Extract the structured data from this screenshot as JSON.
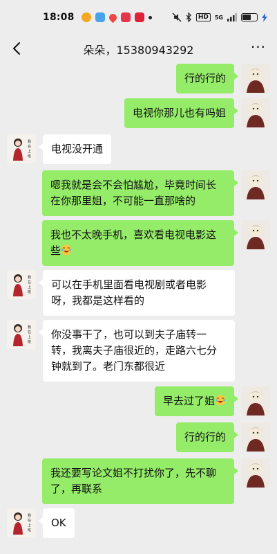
{
  "status_bar": {
    "time": "18:08",
    "signal": "5G",
    "battery_label": "HD",
    "battery_level_percent": 65
  },
  "nav": {
    "title": "朵朵，15380943292",
    "more": "···"
  },
  "colors": {
    "mine_bubble": "#95ec69",
    "theirs_bubble": "#ffffff",
    "background": "#ededed"
  },
  "messages": [
    {
      "from": "me",
      "text": "行的行的"
    },
    {
      "from": "me",
      "text": "电视你那儿也有吗姐"
    },
    {
      "from": "them",
      "text": "电视没开通"
    },
    {
      "from": "me",
      "text": "嗯我就是会不会怕尴尬，毕竟时间长在你那里姐，不可能一直那啥的"
    },
    {
      "from": "me",
      "text": "我也不太晚手机，喜欢看电视电影这些",
      "emoji": "laugh-cry-emoji"
    },
    {
      "from": "them",
      "text": "可以在手机里面看电视剧或者电影呀，我都是这样看的"
    },
    {
      "from": "them",
      "text": "你没事干了，也可以到夫子庙转一转，我离夫子庙很近的，走路六七分钟就到了。老门东都很近"
    },
    {
      "from": "me",
      "text": "早去过了姐",
      "emoji": "laugh-cry-emoji"
    },
    {
      "from": "me",
      "text": "行的行的"
    },
    {
      "from": "me",
      "text": "我还要写论文姐不打扰你了，先不聊了，再联系"
    },
    {
      "from": "them",
      "text": "OK"
    }
  ]
}
